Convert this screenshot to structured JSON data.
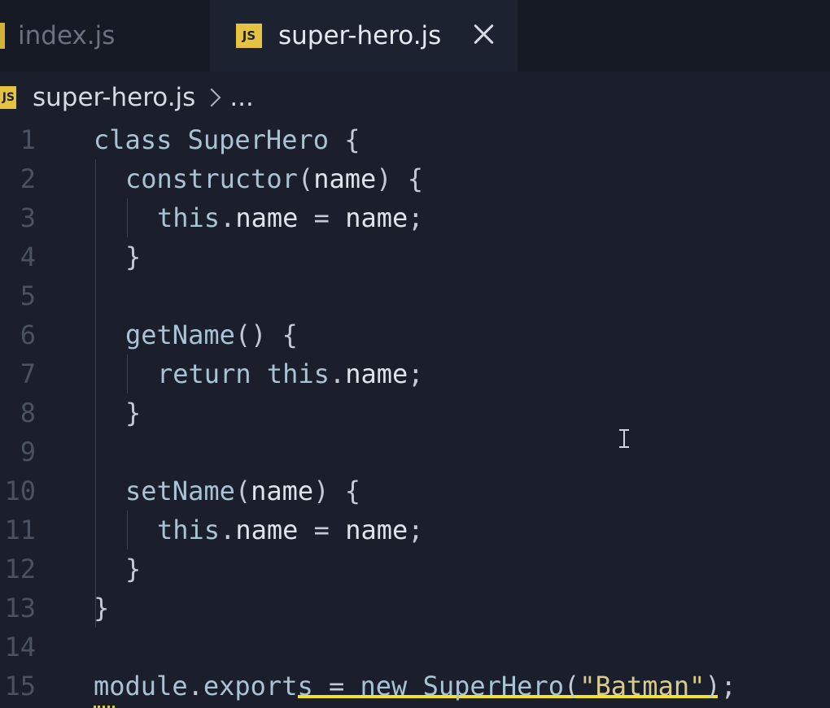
{
  "tabs": [
    {
      "label": "index.js",
      "active": false
    },
    {
      "label": "super-hero.js",
      "active": true,
      "badge": "JS"
    }
  ],
  "breadcrumb": {
    "badge": "JS",
    "file": "super-hero.js",
    "more": "..."
  },
  "code": {
    "lines": [
      {
        "n": "1",
        "indent": 0,
        "html": [
          [
            "kw",
            "class "
          ],
          [
            "fn",
            "SuperHero"
          ],
          [
            "punct",
            " {"
          ]
        ]
      },
      {
        "n": "2",
        "indent": 1,
        "html": [
          [
            "fn",
            "constructor"
          ],
          [
            "punct",
            "("
          ],
          [
            "",
            "name"
          ],
          [
            "punct",
            ") {"
          ]
        ]
      },
      {
        "n": "3",
        "indent": 2,
        "html": [
          [
            "kw",
            "this"
          ],
          [
            "punct",
            "."
          ],
          [
            "",
            "name "
          ],
          [
            "punct",
            "= "
          ],
          [
            "",
            "name"
          ],
          [
            "punct",
            ";"
          ]
        ]
      },
      {
        "n": "4",
        "indent": 1,
        "html": [
          [
            "punct",
            "}"
          ]
        ]
      },
      {
        "n": "5",
        "indent": 0,
        "html": []
      },
      {
        "n": "6",
        "indent": 1,
        "html": [
          [
            "fn",
            "getName"
          ],
          [
            "punct",
            "() {"
          ]
        ]
      },
      {
        "n": "7",
        "indent": 2,
        "html": [
          [
            "kw",
            "return "
          ],
          [
            "kw",
            "this"
          ],
          [
            "punct",
            "."
          ],
          [
            "",
            "name"
          ],
          [
            "punct",
            ";"
          ]
        ]
      },
      {
        "n": "8",
        "indent": 1,
        "html": [
          [
            "punct",
            "}"
          ]
        ]
      },
      {
        "n": "9",
        "indent": 0,
        "html": []
      },
      {
        "n": "10",
        "indent": 1,
        "html": [
          [
            "fn",
            "setName"
          ],
          [
            "punct",
            "("
          ],
          [
            "",
            "name"
          ],
          [
            "punct",
            ") {"
          ]
        ]
      },
      {
        "n": "11",
        "indent": 2,
        "html": [
          [
            "kw",
            "this"
          ],
          [
            "punct",
            "."
          ],
          [
            "",
            "name "
          ],
          [
            "punct",
            "= "
          ],
          [
            "",
            "name"
          ],
          [
            "punct",
            ";"
          ]
        ]
      },
      {
        "n": "12",
        "indent": 1,
        "html": [
          [
            "punct",
            "}"
          ]
        ]
      },
      {
        "n": "13",
        "indent": 0,
        "html": [
          [
            "punct",
            "}"
          ]
        ]
      },
      {
        "n": "14",
        "indent": 0,
        "html": []
      },
      {
        "n": "15",
        "indent": 0,
        "html": [
          [
            "fn",
            "module"
          ],
          [
            "punct",
            "."
          ],
          [
            "fn",
            "exports "
          ],
          [
            "punct",
            "= "
          ],
          [
            "kw",
            "new "
          ],
          [
            "fn",
            "SuperHero"
          ],
          [
            "punct",
            "("
          ],
          [
            "str",
            "\"Batman\""
          ],
          [
            "punct",
            ");"
          ]
        ]
      }
    ]
  },
  "colors": {
    "background": "#1a1f2b",
    "badge": "#e5c242",
    "squiggle": "#f2e12a"
  }
}
